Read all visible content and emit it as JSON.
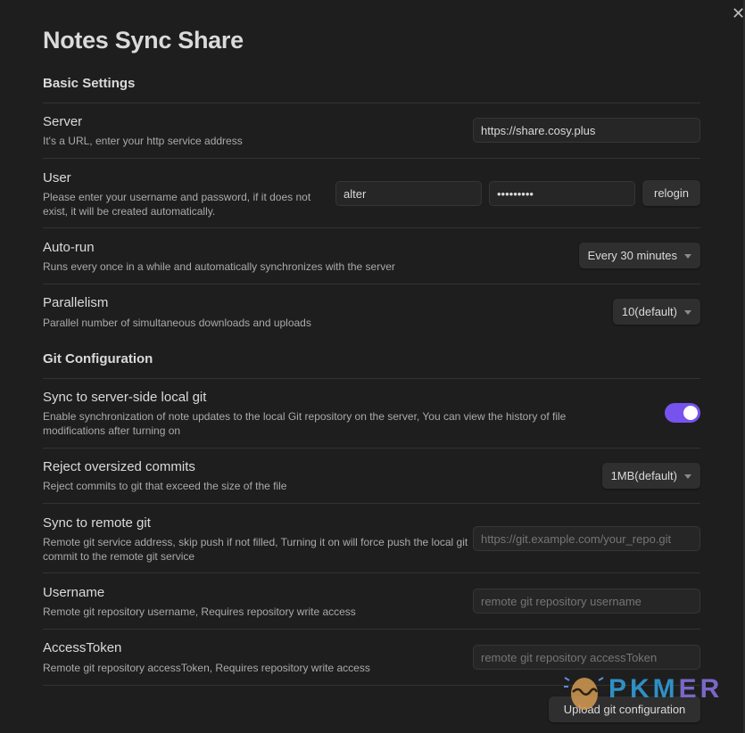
{
  "modal": {
    "title": "Notes Sync Share",
    "close_icon": "close-icon"
  },
  "sections": {
    "basic": "Basic Settings",
    "git": "Git Configuration"
  },
  "server": {
    "name": "Server",
    "desc": "It's a URL, enter your http service address",
    "value": "https://share.cosy.plus"
  },
  "user": {
    "name": "User",
    "desc": "Please enter your username and password, if it does not exist, it will be created automatically.",
    "username_value": "alter",
    "password_value": "•••••••••",
    "relogin_label": "relogin"
  },
  "autorun": {
    "name": "Auto-run",
    "desc": "Runs every once in a while and automatically synchronizes with the server",
    "selected": "Every 30 minutes"
  },
  "parallelism": {
    "name": "Parallelism",
    "desc": "Parallel number of simultaneous downloads and uploads",
    "selected": "10(default)"
  },
  "sync_local_git": {
    "name": "Sync to server-side local git",
    "desc": "Enable synchronization of note updates to the local Git repository on the server, You can view the history of file modifications after turning on",
    "enabled": true,
    "accent": "#7852ee"
  },
  "reject_oversized": {
    "name": "Reject oversized commits",
    "desc": "Reject commits to git that exceed the size of the file",
    "selected": "1MB(default)"
  },
  "remote_git": {
    "name": "Sync to remote git",
    "desc": "Remote git service address, skip push if not filled, Turning it on will force push the local git commit to the remote git service",
    "placeholder": "https://git.example.com/your_repo.git"
  },
  "git_username": {
    "name": "Username",
    "desc": "Remote git repository username, Requires repository write access",
    "placeholder": "remote git repository username"
  },
  "git_token": {
    "name": "AccessToken",
    "desc": "Remote git repository accessToken, Requires repository write access",
    "placeholder": "remote git repository accessToken"
  },
  "upload_button": "Upload git configuration",
  "watermark": {
    "text": "PKMER"
  }
}
